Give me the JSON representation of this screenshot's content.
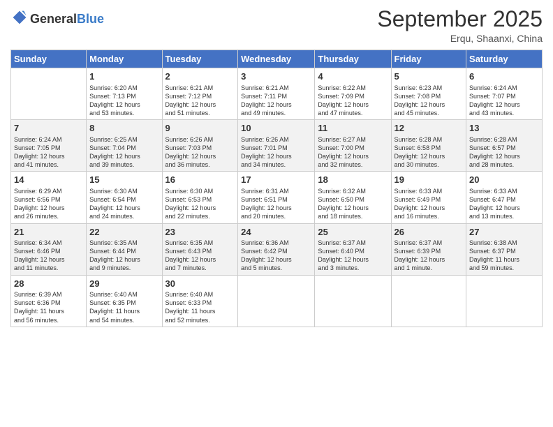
{
  "logo": {
    "general": "General",
    "blue": "Blue"
  },
  "header": {
    "month": "September 2025",
    "location": "Erqu, Shaanxi, China"
  },
  "weekdays": [
    "Sunday",
    "Monday",
    "Tuesday",
    "Wednesday",
    "Thursday",
    "Friday",
    "Saturday"
  ],
  "weeks": [
    {
      "alt": false,
      "days": [
        {
          "num": "",
          "info": ""
        },
        {
          "num": "1",
          "info": "Sunrise: 6:20 AM\nSunset: 7:13 PM\nDaylight: 12 hours\nand 53 minutes."
        },
        {
          "num": "2",
          "info": "Sunrise: 6:21 AM\nSunset: 7:12 PM\nDaylight: 12 hours\nand 51 minutes."
        },
        {
          "num": "3",
          "info": "Sunrise: 6:21 AM\nSunset: 7:11 PM\nDaylight: 12 hours\nand 49 minutes."
        },
        {
          "num": "4",
          "info": "Sunrise: 6:22 AM\nSunset: 7:09 PM\nDaylight: 12 hours\nand 47 minutes."
        },
        {
          "num": "5",
          "info": "Sunrise: 6:23 AM\nSunset: 7:08 PM\nDaylight: 12 hours\nand 45 minutes."
        },
        {
          "num": "6",
          "info": "Sunrise: 6:24 AM\nSunset: 7:07 PM\nDaylight: 12 hours\nand 43 minutes."
        }
      ]
    },
    {
      "alt": true,
      "days": [
        {
          "num": "7",
          "info": "Sunrise: 6:24 AM\nSunset: 7:05 PM\nDaylight: 12 hours\nand 41 minutes."
        },
        {
          "num": "8",
          "info": "Sunrise: 6:25 AM\nSunset: 7:04 PM\nDaylight: 12 hours\nand 39 minutes."
        },
        {
          "num": "9",
          "info": "Sunrise: 6:26 AM\nSunset: 7:03 PM\nDaylight: 12 hours\nand 36 minutes."
        },
        {
          "num": "10",
          "info": "Sunrise: 6:26 AM\nSunset: 7:01 PM\nDaylight: 12 hours\nand 34 minutes."
        },
        {
          "num": "11",
          "info": "Sunrise: 6:27 AM\nSunset: 7:00 PM\nDaylight: 12 hours\nand 32 minutes."
        },
        {
          "num": "12",
          "info": "Sunrise: 6:28 AM\nSunset: 6:58 PM\nDaylight: 12 hours\nand 30 minutes."
        },
        {
          "num": "13",
          "info": "Sunrise: 6:28 AM\nSunset: 6:57 PM\nDaylight: 12 hours\nand 28 minutes."
        }
      ]
    },
    {
      "alt": false,
      "days": [
        {
          "num": "14",
          "info": "Sunrise: 6:29 AM\nSunset: 6:56 PM\nDaylight: 12 hours\nand 26 minutes."
        },
        {
          "num": "15",
          "info": "Sunrise: 6:30 AM\nSunset: 6:54 PM\nDaylight: 12 hours\nand 24 minutes."
        },
        {
          "num": "16",
          "info": "Sunrise: 6:30 AM\nSunset: 6:53 PM\nDaylight: 12 hours\nand 22 minutes."
        },
        {
          "num": "17",
          "info": "Sunrise: 6:31 AM\nSunset: 6:51 PM\nDaylight: 12 hours\nand 20 minutes."
        },
        {
          "num": "18",
          "info": "Sunrise: 6:32 AM\nSunset: 6:50 PM\nDaylight: 12 hours\nand 18 minutes."
        },
        {
          "num": "19",
          "info": "Sunrise: 6:33 AM\nSunset: 6:49 PM\nDaylight: 12 hours\nand 16 minutes."
        },
        {
          "num": "20",
          "info": "Sunrise: 6:33 AM\nSunset: 6:47 PM\nDaylight: 12 hours\nand 13 minutes."
        }
      ]
    },
    {
      "alt": true,
      "days": [
        {
          "num": "21",
          "info": "Sunrise: 6:34 AM\nSunset: 6:46 PM\nDaylight: 12 hours\nand 11 minutes."
        },
        {
          "num": "22",
          "info": "Sunrise: 6:35 AM\nSunset: 6:44 PM\nDaylight: 12 hours\nand 9 minutes."
        },
        {
          "num": "23",
          "info": "Sunrise: 6:35 AM\nSunset: 6:43 PM\nDaylight: 12 hours\nand 7 minutes."
        },
        {
          "num": "24",
          "info": "Sunrise: 6:36 AM\nSunset: 6:42 PM\nDaylight: 12 hours\nand 5 minutes."
        },
        {
          "num": "25",
          "info": "Sunrise: 6:37 AM\nSunset: 6:40 PM\nDaylight: 12 hours\nand 3 minutes."
        },
        {
          "num": "26",
          "info": "Sunrise: 6:37 AM\nSunset: 6:39 PM\nDaylight: 12 hours\nand 1 minute."
        },
        {
          "num": "27",
          "info": "Sunrise: 6:38 AM\nSunset: 6:37 PM\nDaylight: 11 hours\nand 59 minutes."
        }
      ]
    },
    {
      "alt": false,
      "days": [
        {
          "num": "28",
          "info": "Sunrise: 6:39 AM\nSunset: 6:36 PM\nDaylight: 11 hours\nand 56 minutes."
        },
        {
          "num": "29",
          "info": "Sunrise: 6:40 AM\nSunset: 6:35 PM\nDaylight: 11 hours\nand 54 minutes."
        },
        {
          "num": "30",
          "info": "Sunrise: 6:40 AM\nSunset: 6:33 PM\nDaylight: 11 hours\nand 52 minutes."
        },
        {
          "num": "",
          "info": ""
        },
        {
          "num": "",
          "info": ""
        },
        {
          "num": "",
          "info": ""
        },
        {
          "num": "",
          "info": ""
        }
      ]
    }
  ]
}
